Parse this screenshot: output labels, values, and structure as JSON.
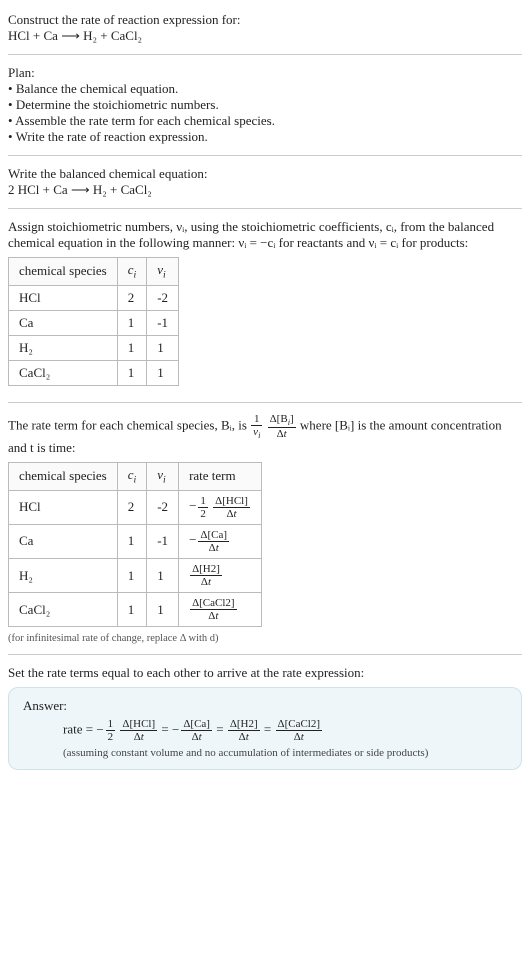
{
  "header": {
    "title": "Construct the rate of reaction expression for:",
    "equation": "HCl + Ca ⟶ H₂ + CaCl₂"
  },
  "plan": {
    "heading": "Plan:",
    "items": [
      "Balance the chemical equation.",
      "Determine the stoichiometric numbers.",
      "Assemble the rate term for each chemical species.",
      "Write the rate of reaction expression."
    ]
  },
  "balanced": {
    "intro": "Write the balanced chemical equation:",
    "equation": "2 HCl + Ca ⟶ H₂ + CaCl₂"
  },
  "stoich": {
    "text_pre": "Assign stoichiometric numbers, νᵢ, using the stoichiometric coefficients, cᵢ, from the balanced chemical equation in the following manner: νᵢ = −cᵢ for reactants and νᵢ = cᵢ for products:",
    "headers": [
      "chemical species",
      "cᵢ",
      "νᵢ"
    ],
    "rows": [
      {
        "species": "HCl",
        "c": "2",
        "v": "-2"
      },
      {
        "species": "Ca",
        "c": "1",
        "v": "-1"
      },
      {
        "species": "H₂",
        "c": "1",
        "v": "1"
      },
      {
        "species": "CaCl₂",
        "c": "1",
        "v": "1"
      }
    ]
  },
  "rateterm": {
    "text_a": "The rate term for each chemical species, Bᵢ, is ",
    "text_b": " where [Bᵢ] is the amount concentration and t is time:",
    "headers": [
      "chemical species",
      "cᵢ",
      "νᵢ",
      "rate term"
    ],
    "rows": [
      {
        "species": "HCl",
        "c": "2",
        "v": "-2",
        "coef_num": "1",
        "coef_den": "2",
        "neg": true,
        "delta": "Δ[HCl]"
      },
      {
        "species": "Ca",
        "c": "1",
        "v": "-1",
        "coef_num": "",
        "coef_den": "",
        "neg": true,
        "delta": "Δ[Ca]"
      },
      {
        "species": "H₂",
        "c": "1",
        "v": "1",
        "coef_num": "",
        "coef_den": "",
        "neg": false,
        "delta": "Δ[H2]"
      },
      {
        "species": "CaCl₂",
        "c": "1",
        "v": "1",
        "coef_num": "",
        "coef_den": "",
        "neg": false,
        "delta": "Δ[CaCl2]"
      }
    ],
    "footnote": "(for infinitesimal rate of change, replace Δ with d)"
  },
  "final": {
    "intro": "Set the rate terms equal to each other to arrive at the rate expression:",
    "answer_label": "Answer:",
    "rate_prefix": "rate = ",
    "terms": [
      {
        "neg": true,
        "coef_num": "1",
        "coef_den": "2",
        "delta": "Δ[HCl]"
      },
      {
        "neg": true,
        "coef_num": "",
        "coef_den": "",
        "delta": "Δ[Ca]"
      },
      {
        "neg": false,
        "coef_num": "",
        "coef_den": "",
        "delta": "Δ[H2]"
      },
      {
        "neg": false,
        "coef_num": "",
        "coef_den": "",
        "delta": "Δ[CaCl2]"
      }
    ],
    "note": "(assuming constant volume and no accumulation of intermediates or side products)"
  },
  "chart_data": {
    "type": "table",
    "tables": [
      {
        "title": "stoichiometric numbers",
        "columns": [
          "chemical species",
          "c_i",
          "ν_i"
        ],
        "rows": [
          [
            "HCl",
            2,
            -2
          ],
          [
            "Ca",
            1,
            -1
          ],
          [
            "H2",
            1,
            1
          ],
          [
            "CaCl2",
            1,
            1
          ]
        ]
      },
      {
        "title": "rate terms",
        "columns": [
          "chemical species",
          "c_i",
          "ν_i",
          "rate term"
        ],
        "rows": [
          [
            "HCl",
            2,
            -2,
            "-(1/2) Δ[HCl]/Δt"
          ],
          [
            "Ca",
            1,
            -1,
            "-Δ[Ca]/Δt"
          ],
          [
            "H2",
            1,
            1,
            "Δ[H2]/Δt"
          ],
          [
            "CaCl2",
            1,
            1,
            "Δ[CaCl2]/Δt"
          ]
        ]
      }
    ]
  }
}
